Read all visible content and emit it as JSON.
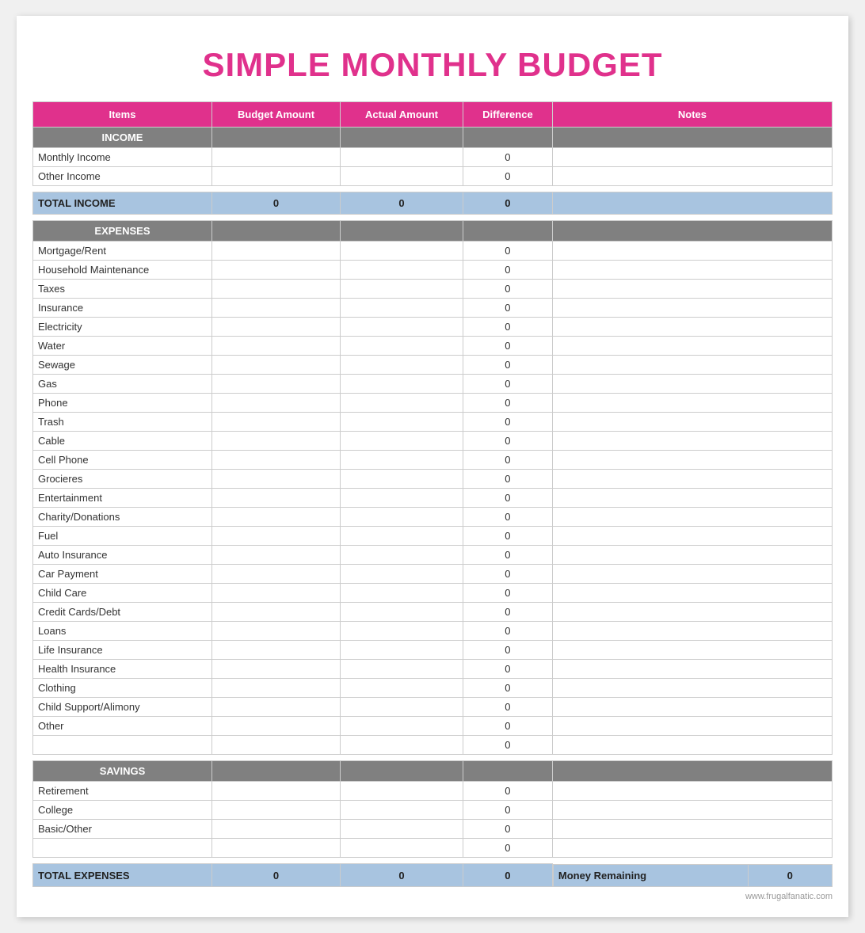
{
  "title": "SIMPLE MONTHLY BUDGET",
  "columns": {
    "items": "Items",
    "budget": "Budget Amount",
    "actual": "Actual Amount",
    "difference": "Difference",
    "notes": "Notes"
  },
  "sections": {
    "income": {
      "label": "INCOME",
      "rows": [
        {
          "item": "Monthly Income",
          "difference": "0"
        },
        {
          "item": "Other Income",
          "difference": "0"
        }
      ],
      "total": {
        "label": "TOTAL INCOME",
        "budget": "0",
        "actual": "0",
        "difference": "0"
      }
    },
    "expenses": {
      "label": "EXPENSES",
      "rows": [
        {
          "item": "Mortgage/Rent",
          "difference": "0"
        },
        {
          "item": "Household Maintenance",
          "difference": "0"
        },
        {
          "item": "Taxes",
          "difference": "0"
        },
        {
          "item": "Insurance",
          "difference": "0"
        },
        {
          "item": "Electricity",
          "difference": "0"
        },
        {
          "item": "Water",
          "difference": "0"
        },
        {
          "item": "Sewage",
          "difference": "0"
        },
        {
          "item": "Gas",
          "difference": "0"
        },
        {
          "item": "Phone",
          "difference": "0"
        },
        {
          "item": "Trash",
          "difference": "0"
        },
        {
          "item": "Cable",
          "difference": "0"
        },
        {
          "item": "Cell Phone",
          "difference": "0"
        },
        {
          "item": "Grocieres",
          "difference": "0"
        },
        {
          "item": "Entertainment",
          "difference": "0"
        },
        {
          "item": "Charity/Donations",
          "difference": "0"
        },
        {
          "item": "Fuel",
          "difference": "0"
        },
        {
          "item": "Auto Insurance",
          "difference": "0"
        },
        {
          "item": "Car Payment",
          "difference": "0"
        },
        {
          "item": "Child Care",
          "difference": "0"
        },
        {
          "item": "Credit Cards/Debt",
          "difference": "0"
        },
        {
          "item": "Loans",
          "difference": "0"
        },
        {
          "item": "Life Insurance",
          "difference": "0"
        },
        {
          "item": "Health Insurance",
          "difference": "0"
        },
        {
          "item": "Clothing",
          "difference": "0"
        },
        {
          "item": "Child Support/Alimony",
          "difference": "0"
        },
        {
          "item": "Other",
          "difference": "0"
        },
        {
          "item": "",
          "difference": "0"
        }
      ]
    },
    "savings": {
      "label": "SAVINGS",
      "rows": [
        {
          "item": "Retirement",
          "difference": "0"
        },
        {
          "item": "College",
          "difference": "0"
        },
        {
          "item": "Basic/Other",
          "difference": "0"
        },
        {
          "item": "",
          "difference": "0"
        }
      ],
      "total": {
        "label": "TOTAL EXPENSES",
        "budget": "0",
        "actual": "0",
        "difference": "0",
        "money_remaining_label": "Money Remaining",
        "money_remaining_value": "0"
      }
    }
  },
  "footer": "www.frugalfanatic.com"
}
